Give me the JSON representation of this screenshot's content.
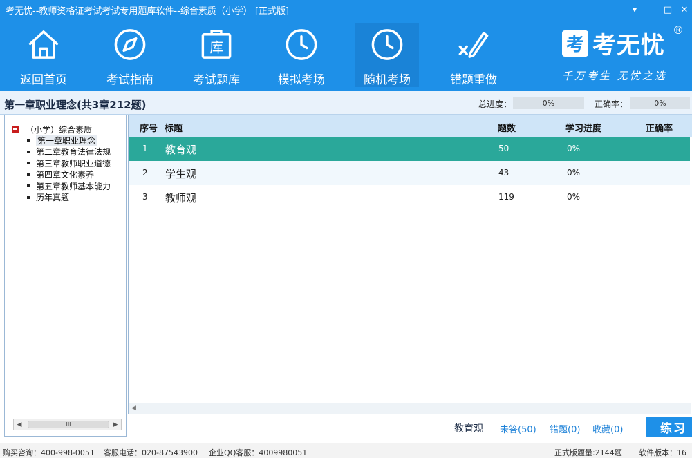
{
  "window": {
    "title": "考无忧--教师资格证考试考试专用题库软件--综合素质（小学） [正式版]",
    "controls": [
      "▾",
      "–",
      "□",
      "✕"
    ]
  },
  "toolbar": {
    "items": [
      {
        "label": "返回首页",
        "icon": "home-icon"
      },
      {
        "label": "考试指南",
        "icon": "compass-icon"
      },
      {
        "label": "考试题库",
        "icon": "library-icon",
        "icon_text": "库"
      },
      {
        "label": "模拟考场",
        "icon": "clock-icon"
      },
      {
        "label": "随机考场",
        "icon": "clock-icon"
      },
      {
        "label": "错题重做",
        "icon": "check-pen-icon"
      }
    ],
    "active_index": 4
  },
  "brand": {
    "mark": "考",
    "name": "考无忧",
    "registered": "®",
    "slogan": "千万考生  无忧之选"
  },
  "chapter_bar": {
    "title": "第一章职业理念(共3章212题)",
    "total_progress_label": "总进度：",
    "total_progress_value": "0%",
    "accuracy_label": "正确率：",
    "accuracy_value": "0%"
  },
  "tree": {
    "root": "（小学）综合素质",
    "items": [
      {
        "label": "第一章职业理念",
        "selected": true
      },
      {
        "label": "第二章教育法律法规",
        "selected": false
      },
      {
        "label": "第三章教师职业道德",
        "selected": false
      },
      {
        "label": "第四章文化素养",
        "selected": false
      },
      {
        "label": "第五章教师基本能力",
        "selected": false
      },
      {
        "label": "历年真题",
        "selected": false
      }
    ],
    "scroll_thumb": "III"
  },
  "table": {
    "headers": {
      "no": "序号",
      "title": "标题",
      "count": "题数",
      "progress": "学习进度",
      "accuracy": "正确率"
    },
    "rows": [
      {
        "no": "1",
        "title": "教育观",
        "count": "50",
        "progress": "0%",
        "selected": true
      },
      {
        "no": "2",
        "title": "学生观",
        "count": "43",
        "progress": "0%",
        "selected": false
      },
      {
        "no": "3",
        "title": "教师观",
        "count": "119",
        "progress": "0%",
        "selected": false
      }
    ]
  },
  "actions": {
    "current": "教育观",
    "unanswered": "未答(50)",
    "wrong": "错题(0)",
    "favorites": "收藏(0)",
    "practice": "练习"
  },
  "status": {
    "purchase": "购买咨询：400-998-0051",
    "phone": "客服电话：020-87543900",
    "qq": "企业QQ客服：4009980051",
    "total": "正式版题量:2144题",
    "version": "软件版本：16"
  },
  "colors": {
    "primary": "#1e90e8",
    "selected_row": "#2aa89a",
    "link": "#1e82d8"
  }
}
